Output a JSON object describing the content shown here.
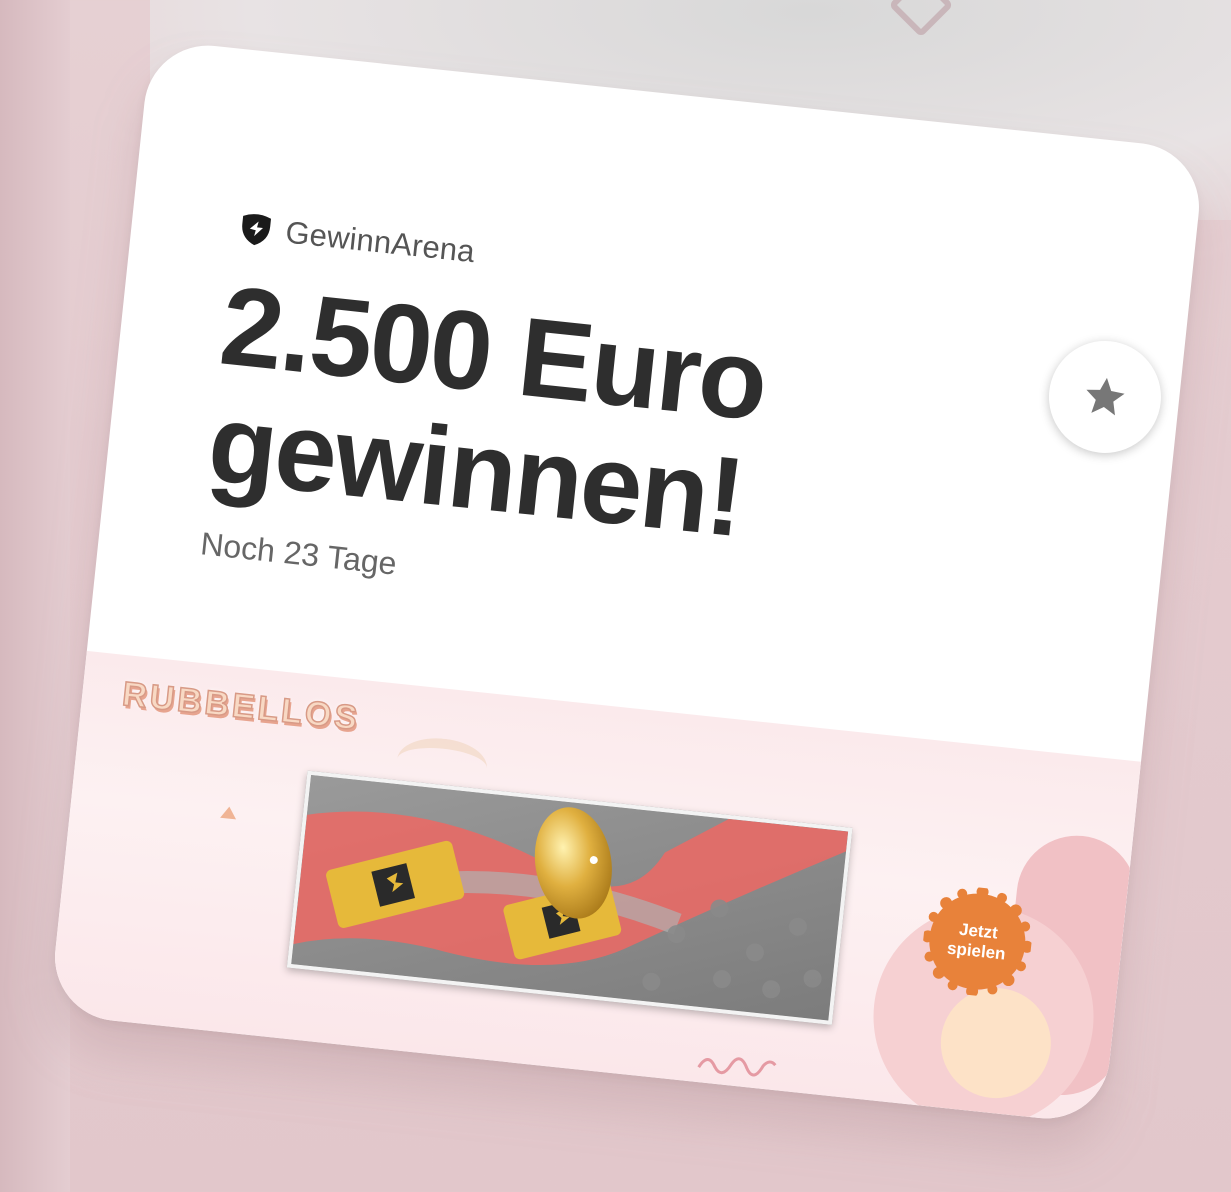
{
  "card": {
    "brand_name": "GewinnArena",
    "title_line1": "2.500 Euro",
    "title_line2": "gewinnen!",
    "remaining": "Noch 23 Tage",
    "favorite_icon": "star-icon"
  },
  "banner": {
    "title": "RUBBELLOS",
    "play_label": "Jetzt\nspielen",
    "accent_color": "#e8823a"
  },
  "colors": {
    "background": "#e4cbcf",
    "card": "#ffffff",
    "headline": "#2e2e2e"
  }
}
